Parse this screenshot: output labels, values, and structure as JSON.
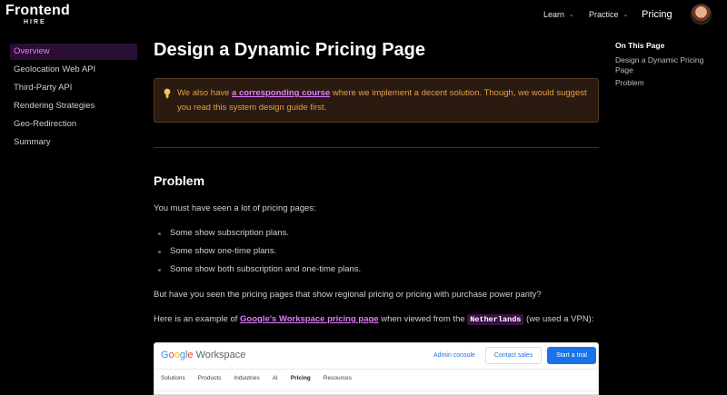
{
  "nav": {
    "logo_word": "Frontend",
    "logo_sub": "HIRE",
    "learn": "Learn",
    "practice": "Practice",
    "pricing": "Pricing",
    "chevron": "⌄"
  },
  "sidebar": {
    "items": [
      {
        "label": "Overview",
        "active": true
      },
      {
        "label": "Geolocation Web API"
      },
      {
        "label": "Third-Party API"
      },
      {
        "label": "Rendering Strategies"
      },
      {
        "label": "Geo-Redirection"
      },
      {
        "label": "Summary"
      }
    ]
  },
  "main": {
    "title": "Design a Dynamic Pricing Page",
    "callout": {
      "text_before": "We also have ",
      "link": "a corresponding course",
      "text_after": " where we implement a decent solution. Though, we would suggest you read this system design guide first."
    },
    "problem_heading": "Problem",
    "intro": "You must have seen a lot of pricing pages:",
    "bullets": [
      "Some show subscription plans.",
      "Some show one-time plans.",
      "Some show both subscription and one-time plans."
    ],
    "question": "But have you seen the pricing pages that show regional pricing or pricing with purchase power parity?",
    "example_before": "Here is an example of ",
    "example_link": "Google's Workspace pricing page",
    "example_mid": " when viewed from the ",
    "example_code": "Netherlands",
    "example_after": " (we used a VPN):",
    "screenshot": {
      "logo_g": "G",
      "logo_o1": "o",
      "logo_o2": "o",
      "logo_g2": "g",
      "logo_l": "l",
      "logo_e": "e",
      "logo_rest": " Workspace",
      "admin": "Admin console",
      "contact": "Contact sales",
      "trial": "Start a trial",
      "tabs": [
        "Solutions",
        "Products",
        "Industries",
        "AI",
        "Pricing",
        "Resources"
      ]
    }
  },
  "toc": {
    "title": "On This Page",
    "items": [
      "Design a Dynamic Pricing Page",
      "Problem"
    ]
  },
  "colors": {
    "accent": "#e27cff",
    "callout_text": "#e4a046",
    "callout_bg": "#2a1a10"
  }
}
